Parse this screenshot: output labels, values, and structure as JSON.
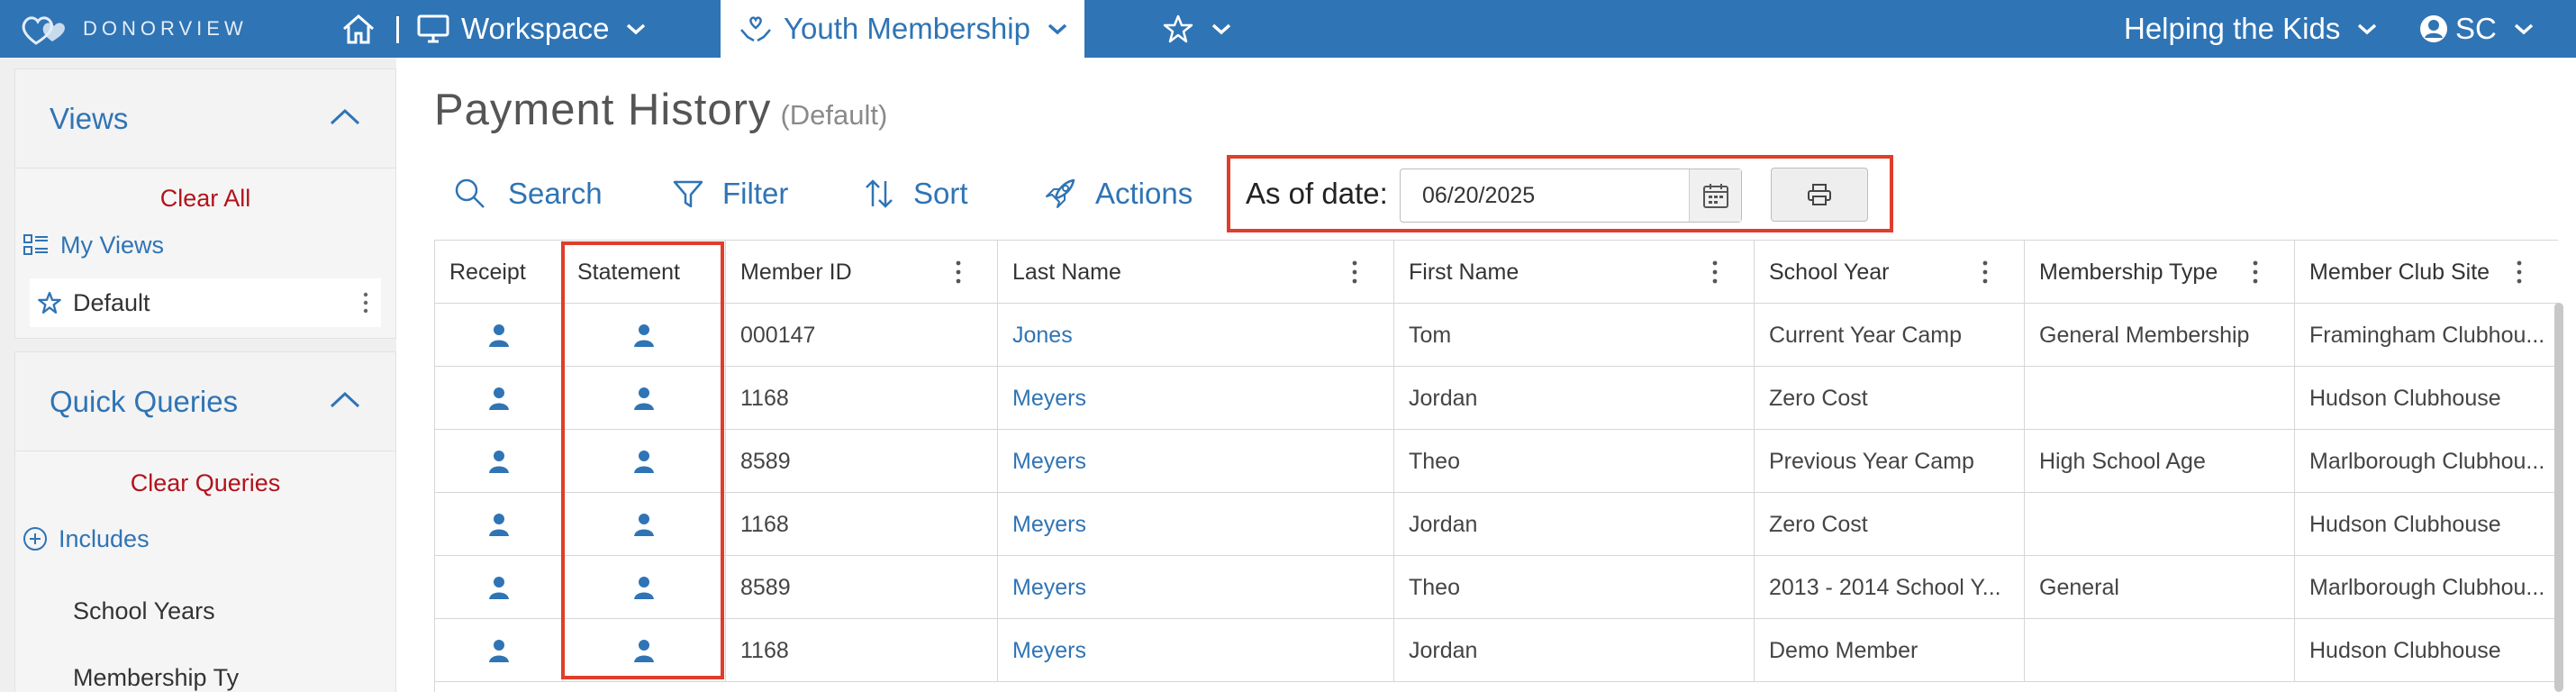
{
  "app": {
    "logo_text": "DONORVIEW",
    "nav": {
      "workspace_label": "Workspace",
      "active_tab_label": "Youth Membership",
      "org_label": "Helping the Kids",
      "user_initials": "SC"
    }
  },
  "sidebar": {
    "views": {
      "title": "Views",
      "clear_label": "Clear All",
      "items": [
        {
          "label": "My Views",
          "icon": "grid-list-icon"
        },
        {
          "label": "Default",
          "icon": "star-outline-icon"
        }
      ]
    },
    "quick_queries": {
      "title": "Quick Queries",
      "clear_label": "Clear Queries",
      "includes_label": "Includes",
      "items": [
        "School Years",
        "Membership Ty"
      ]
    }
  },
  "page": {
    "title": "Payment History",
    "subtitle": "(Default)"
  },
  "toolbar": {
    "search_label": "Search",
    "filter_label": "Filter",
    "sort_label": "Sort",
    "actions_label": "Actions",
    "as_of_label": "As of date:",
    "as_of_value": "06/20/2025"
  },
  "table": {
    "columns": [
      "Receipt",
      "Statement",
      "Member ID",
      "Last Name",
      "First Name",
      "School Year",
      "Membership Type",
      "Member Club Site"
    ],
    "rows": [
      {
        "member_id": "000147",
        "last_name": "Jones",
        "first_name": "Tom",
        "school_year": "Current Year Camp",
        "membership_type": "General Membership",
        "club_site": "Framingham Clubhou..."
      },
      {
        "member_id": "1168",
        "last_name": "Meyers",
        "first_name": "Jordan",
        "school_year": "Zero Cost",
        "membership_type": "",
        "club_site": "Hudson Clubhouse"
      },
      {
        "member_id": "8589",
        "last_name": "Meyers",
        "first_name": "Theo",
        "school_year": "Previous Year Camp",
        "membership_type": "High School Age",
        "club_site": "Marlborough Clubhou..."
      },
      {
        "member_id": "1168",
        "last_name": "Meyers",
        "first_name": "Jordan",
        "school_year": "Zero Cost",
        "membership_type": "",
        "club_site": "Hudson Clubhouse"
      },
      {
        "member_id": "8589",
        "last_name": "Meyers",
        "first_name": "Theo",
        "school_year": "2013 - 2014 School Y...",
        "membership_type": "General",
        "club_site": "Marlborough Clubhou..."
      },
      {
        "member_id": "1168",
        "last_name": "Meyers",
        "first_name": "Jordan",
        "school_year": "Demo Member",
        "membership_type": "",
        "club_site": "Hudson Clubhouse"
      }
    ]
  },
  "colors": {
    "brand_blue": "#2f74b5",
    "clear_red": "#b3121c",
    "highlight_red": "#e03d2a"
  }
}
